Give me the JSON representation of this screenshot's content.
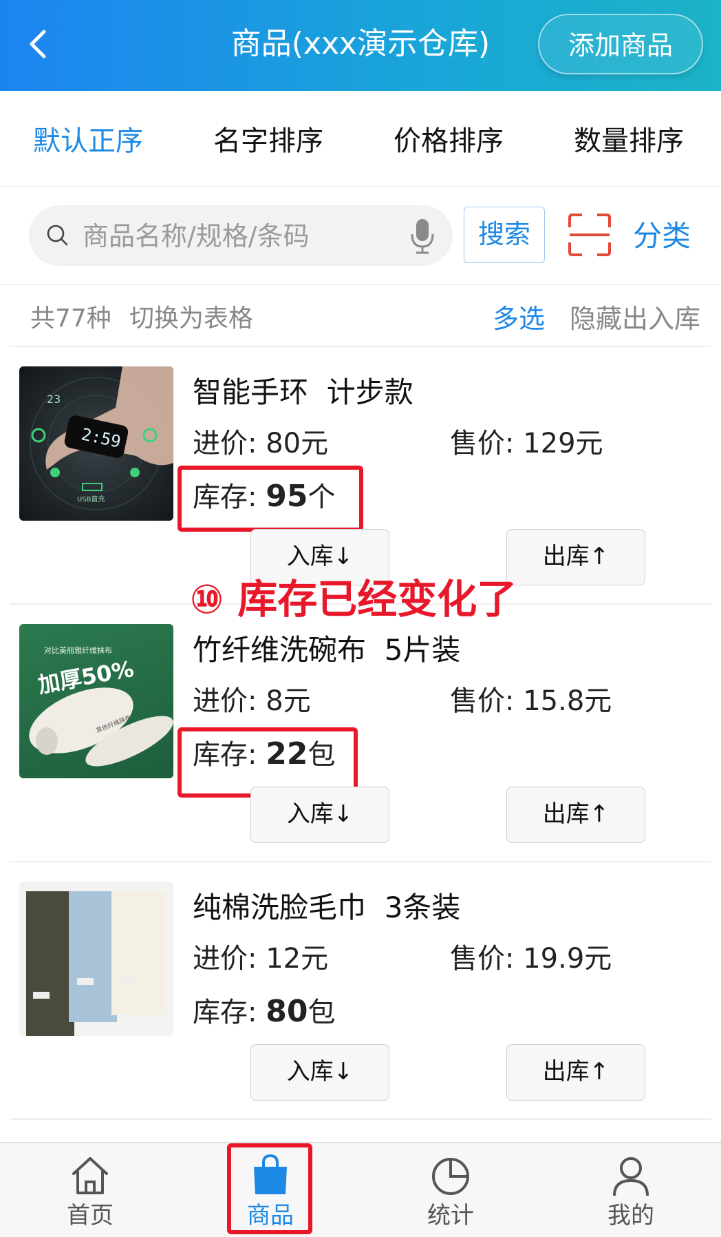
{
  "header": {
    "title": "商品(xxx演示仓库)",
    "add_button": "添加商品"
  },
  "sort_tabs": [
    "默认正序",
    "名字排序",
    "价格排序",
    "数量排序"
  ],
  "search": {
    "placeholder": "商品名称/规格/条码",
    "button": "搜索",
    "category": "分类"
  },
  "summary": {
    "total": "共77种",
    "switch_table": "切换为表格",
    "multi_select": "多选",
    "hide_io": "隐藏出入库"
  },
  "products": [
    {
      "name": "智能手环  计步款",
      "cost_label": "进价:",
      "cost": "80元",
      "price_label": "售价:",
      "price": "129元",
      "stock_label": "库存:",
      "stock_qty": "95",
      "stock_unit": "个",
      "in_button": "入库↓",
      "out_button": "出库↑",
      "thumb_text": [
        "23",
        "2:59",
        "USB直充"
      ]
    },
    {
      "name": "竹纤维洗碗布  5片装",
      "cost_label": "进价:",
      "cost": "8元",
      "price_label": "售价:",
      "price": "15.8元",
      "stock_label": "库存:",
      "stock_qty": "22",
      "stock_unit": "包",
      "in_button": "入库↓",
      "out_button": "出库↑",
      "thumb_text": [
        "对比美丽雅纤维抹布",
        "加厚50%",
        "其他纤维抹布"
      ]
    },
    {
      "name": "纯棉洗脸毛巾  3条装",
      "cost_label": "进价:",
      "cost": "12元",
      "price_label": "售价:",
      "price": "19.9元",
      "stock_label": "库存:",
      "stock_qty": "80",
      "stock_unit": "包",
      "in_button": "入库↓",
      "out_button": "出库↑"
    }
  ],
  "annotation": "⑩ 库存已经变化了",
  "bottom_nav": [
    {
      "label": "首页",
      "icon": "home-icon"
    },
    {
      "label": "商品",
      "icon": "shopping-bag-icon"
    },
    {
      "label": "统计",
      "icon": "pie-chart-icon"
    },
    {
      "label": "我的",
      "icon": "user-icon"
    }
  ],
  "colors": {
    "accent": "#1e88e5",
    "highlight": "#e8182a",
    "header_from": "#1c84f0",
    "header_to": "#1bb3c7"
  }
}
